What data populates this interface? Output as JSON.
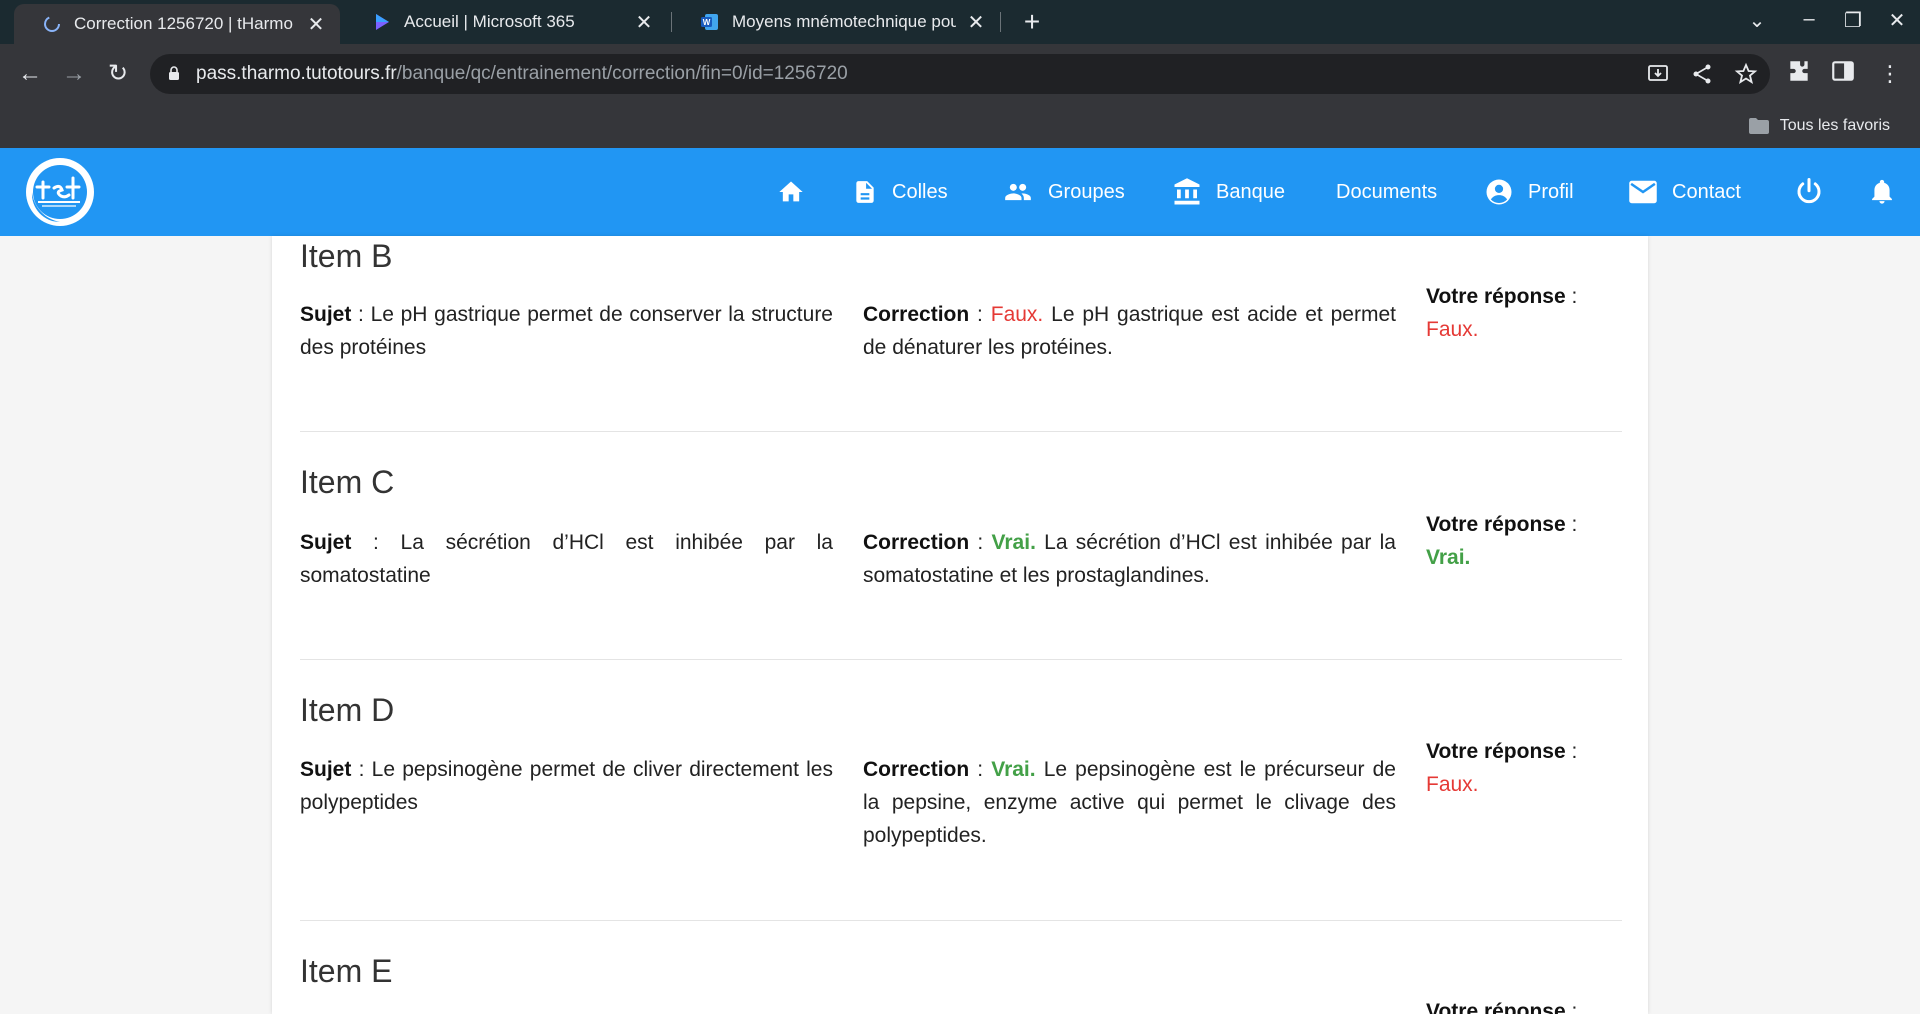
{
  "browser": {
    "tabs": [
      {
        "title": "Correction 1256720 | tHarmo",
        "active": true
      },
      {
        "title": "Accueil | Microsoft 365",
        "active": false
      },
      {
        "title": "Moyens mnémotechnique pour",
        "active": false
      }
    ],
    "url_host": "pass.tharmo.tutotours.fr",
    "url_path": "/banque/qc/entrainement/correction/fin=0/id=1256720",
    "bookmarks_label": "Tous les favoris"
  },
  "nav": {
    "items": [
      "Colles",
      "Groupes",
      "Banque",
      "Documents",
      "Profil",
      "Contact"
    ]
  },
  "labels": {
    "sujet": "Sujet",
    "correction": "Correction",
    "votre_reponse": "Votre réponse"
  },
  "items": [
    {
      "title": "Item B",
      "sujet": "Le pH gastrique permet de conserver la structure des protéines",
      "correction_verdict": "Faux.",
      "correction_text": "Le pH gastrique est acide et permet de dénaturer les protéines.",
      "reponse": "Faux."
    },
    {
      "title": "Item C",
      "sujet": "La sécrétion d’HCl est inhibée par la somatostatine",
      "correction_verdict": "Vrai.",
      "correction_text": "La sécrétion d’HCl est inhibée par la somatostatine et les prostaglandines.",
      "reponse": "Vrai."
    },
    {
      "title": "Item D",
      "sujet": "Le pepsinogène permet de cliver directement les polypeptides",
      "correction_verdict": "Vrai.",
      "correction_text": "Le pepsinogène est le précurseur de la pepsine, enzyme active qui permet le clivage des polypeptides.",
      "reponse": "Faux."
    },
    {
      "title": "Item E",
      "sujet": "",
      "correction_verdict": "",
      "correction_text": "",
      "reponse": ""
    }
  ],
  "colors": {
    "brand": "#2196f3",
    "vrai": "#43a047",
    "faux": "#e53935"
  }
}
